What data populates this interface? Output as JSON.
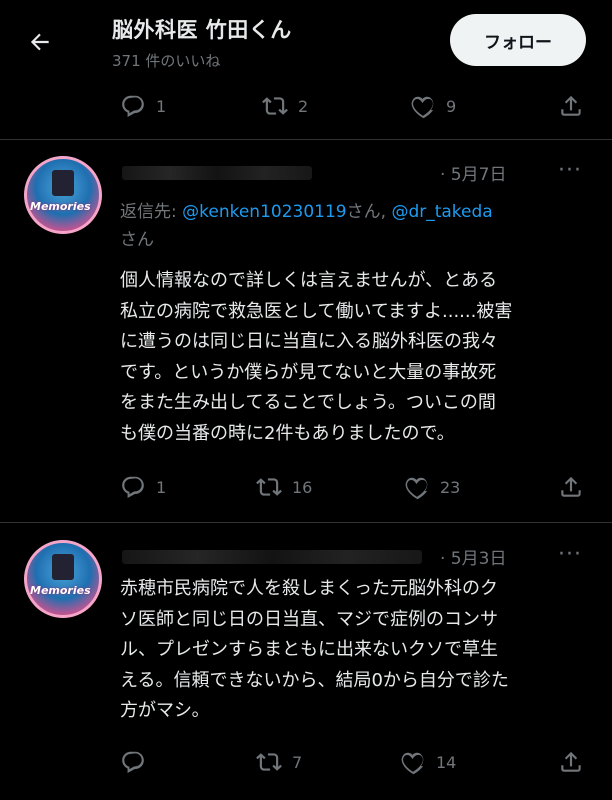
{
  "header": {
    "title": "脳外科医 竹田くん",
    "subtitle": "371 件のいいね",
    "follow_label": "フォロー"
  },
  "top_actions": {
    "replies": "1",
    "retweets": "2",
    "likes": "9"
  },
  "tweets": [
    {
      "date": "· 5月7日",
      "more": "···",
      "reply_prefix": "返信先: ",
      "mention1": "@kenken10230119",
      "reply_mid": "さん, ",
      "mention2": "@dr_takeda",
      "reply_suffix": "さん",
      "body": "個人情報なので詳しくは言えませんが、とある\n私立の病院で救急医として働いてますよ......被害\nに遭うのは同じ日に当直に入る脳外科医の我々\nです。というか僕らが見てないと大量の事故死\nをまた生み出してることでしょう。ついこの間\nも僕の当番の時に2件もありましたので。",
      "avatar_text": "Memories",
      "replies": "1",
      "retweets": "16",
      "likes": "23"
    },
    {
      "date": "· 5月3日",
      "more": "···",
      "body": "赤穂市民病院で人を殺しまくった元脳外科のク\nソ医師と同じ日の日当直、マジで症例のコンサ\nル、プレゼンすらまともに出来ないクソで草生\nえる。信頼できないから、結局0から自分で診た\n方がマシ。",
      "avatar_text": "Memories",
      "replies": "",
      "retweets": "7",
      "likes": "14"
    }
  ],
  "icons": [
    "back-arrow-icon",
    "reply-icon",
    "retweet-icon",
    "like-icon",
    "share-icon",
    "more-icon"
  ],
  "colors": {
    "background": "#000000",
    "text": "#e7e9ea",
    "muted": "#71767b",
    "link": "#1d9bf0",
    "divider": "#2f3336"
  }
}
